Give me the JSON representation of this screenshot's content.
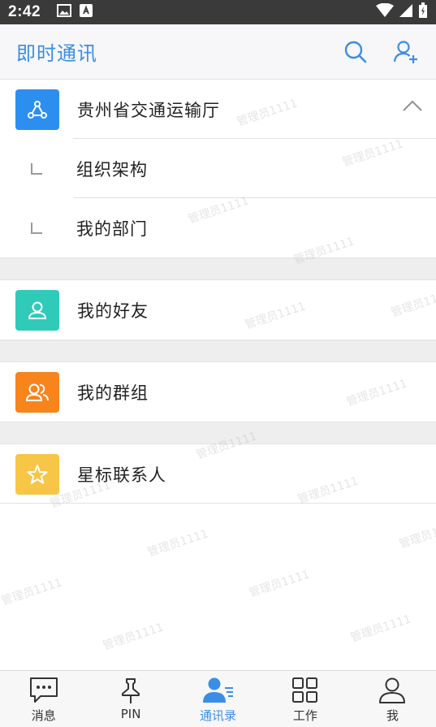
{
  "status_bar": {
    "time": "2:42"
  },
  "header": {
    "title": "即时通讯"
  },
  "org": {
    "name": "贵州省交通运输厅",
    "children": [
      {
        "label": "组织架构"
      },
      {
        "label": "我的部门"
      }
    ]
  },
  "entries": {
    "friends": "我的好友",
    "groups": "我的群组",
    "starred": "星标联系人"
  },
  "watermark": "管理员1111",
  "colors": {
    "accent": "#3a8ee6",
    "org_icon": "#2c8ff0",
    "friends_icon": "#2fcbb8",
    "groups_icon": "#f8841c",
    "starred_icon": "#f7c646"
  },
  "tabs": [
    {
      "label": "消息",
      "icon": "chat-icon"
    },
    {
      "label": "PIN",
      "icon": "pin-icon"
    },
    {
      "label": "通讯录",
      "icon": "contacts-icon",
      "active": true
    },
    {
      "label": "工作",
      "icon": "grid-icon"
    },
    {
      "label": "我",
      "icon": "person-icon"
    }
  ]
}
